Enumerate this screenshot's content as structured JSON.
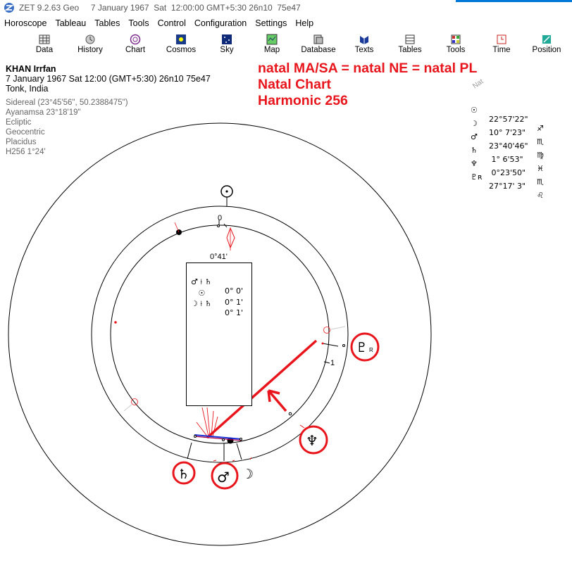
{
  "window": {
    "title": "ZET 9.2.63 Geo     7 January 1967  Sat  12:00:00 GMT+5:30 26n10  75e47",
    "accent_color": "#0078d7"
  },
  "menu": [
    "Horoscope",
    "Tableau",
    "Tables",
    "Tools",
    "Control",
    "Configuration",
    "Settings",
    "Help"
  ],
  "toolbar": [
    {
      "label": "Data",
      "icon": "data-icon"
    },
    {
      "label": "History",
      "icon": "history-icon"
    },
    {
      "label": "Chart",
      "icon": "chart-icon"
    },
    {
      "label": "Cosmos",
      "icon": "cosmos-icon"
    },
    {
      "label": "Sky",
      "icon": "sky-icon"
    },
    {
      "label": "Map",
      "icon": "map-icon"
    },
    {
      "label": "Database",
      "icon": "database-icon"
    },
    {
      "label": "Texts",
      "icon": "texts-icon"
    },
    {
      "label": "Tables",
      "icon": "tables-icon"
    },
    {
      "label": "Tools",
      "icon": "tools-icon"
    },
    {
      "label": "Time",
      "icon": "time-icon"
    },
    {
      "label": "Position",
      "icon": "position-icon"
    }
  ],
  "info": {
    "name": "KHAN Irrfan",
    "datetime": "7 January 1967  Sat  12:00 (GMT+5:30)  26n10  75e47",
    "place": "Tonk, India",
    "details": [
      "Sidereal (23°45'56\", 50.2388475\")",
      "Ayanamsa 23°18'19\"",
      "Ecliptic",
      "Geocentric",
      "Placidus",
      "H256   1°24'"
    ]
  },
  "annotation": {
    "lines": [
      "natal MA/SA = natal NE = natal PL",
      "Natal Chart",
      "Harmonic 256"
    ],
    "color": "#e8161c"
  },
  "legend": {
    "label": "Nat",
    "rows": [
      {
        "symbol": "☉",
        "position": "22°57'22\"",
        "sign": "♐"
      },
      {
        "symbol": "☽",
        "position": "10° 7'23\"",
        "sign": "♏"
      },
      {
        "symbol": "♂",
        "position": "23°40'46\"",
        "sign": "♍"
      },
      {
        "symbol": "♄",
        "position": " 1° 6'53\"",
        "sign": "♓"
      },
      {
        "symbol": "♆",
        "position": " 0°23'50\"",
        "sign": "♏"
      },
      {
        "symbol": "♇ʀ",
        "position": "27°17' 3\"",
        "sign": "♌"
      }
    ]
  },
  "aspect_box": {
    "orb_header": "0°41'",
    "rows": [
      {
        "pair": "♂ ⟊ ♄",
        "orb": "0° 0'"
      },
      {
        "pair": "   ☉",
        "orb": "0° 1'"
      },
      {
        "pair": "☽ ⟊ ♄",
        "orb": "0° 1'"
      }
    ]
  },
  "wheel": {
    "zero_label": "0",
    "one_label": "1",
    "planets": {
      "sun": "☉",
      "pluto": "♇",
      "pluto_retro": "R",
      "neptune": "♆",
      "saturn": "♄",
      "mars": "♂",
      "moon": "☽"
    }
  }
}
